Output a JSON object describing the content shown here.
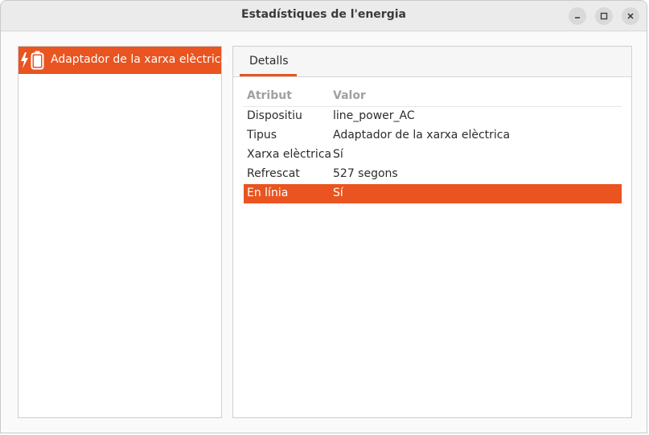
{
  "window": {
    "title": "Estadístiques de l'energia"
  },
  "sidebar": {
    "items": [
      {
        "label": "Adaptador de la xarxa elèctrica",
        "icon": "ac-power-icon"
      }
    ]
  },
  "panel": {
    "tabs": [
      {
        "label": "Detalls"
      }
    ],
    "table": {
      "headers": [
        "Atribut",
        "Valor"
      ],
      "rows": [
        {
          "attribute": "Dispositiu",
          "value": "line_power_AC"
        },
        {
          "attribute": "Tipus",
          "value": "Adaptador de la xarxa elèctrica"
        },
        {
          "attribute": "Xarxa elèctrica",
          "value": "Sí"
        },
        {
          "attribute": "Refrescat",
          "value": "527 segons"
        },
        {
          "attribute": "En línia",
          "value": "Sí"
        }
      ],
      "selected_row_index": 4
    }
  },
  "colors": {
    "accent": "#e95420",
    "header_text": "#a0a0a0"
  }
}
